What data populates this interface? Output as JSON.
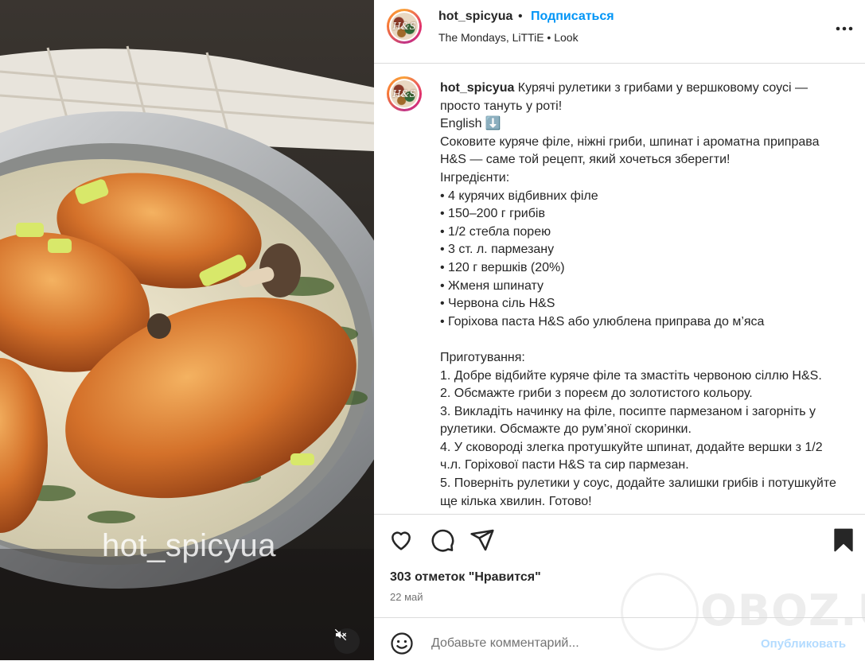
{
  "post": {
    "username": "hot_spicyua",
    "separator": "•",
    "follow_label": "Подписаться",
    "audio_line": "The Mondays, LiTTiE • Look",
    "avatar_text": "H&S",
    "video_watermark": "hot_spicyua"
  },
  "caption": {
    "username": "hot_spicyua",
    "first_line": " Курячі рулетики з грибами у вершковому соусі — просто тануть у роті!",
    "lines": [
      "English ⬇️",
      "Соковите куряче філе, ніжні гриби, шпинат і ароматна приправа H&S — саме той рецепт, який хочеться зберегти!",
      "Інгредієнти:",
      "• 4 курячих відбивних філе",
      "• 150–200 г грибів",
      "• 1/2 стебла порею",
      "• 3 ст. л. пармезану",
      "• 120 г вершків (20%)",
      "• Жменя шпинату",
      "• Червона сіль H&S",
      "• Горіхова паста H&S або улюблена приправа до м’яса",
      "",
      "Приготування:",
      "1. Добре відбийте куряче філе та змастіть червоною сіллю H&S.",
      "2. Обсмажте гриби з пореєм до золотистого кольору.",
      "3. Викладіть начинку на філе, посипте пармезаном і загорніть у рулетики. Обсмажте до рум’яної скоринки.",
      "4. У сковороді злегка протушкуйте шпинат, додайте вершки з 1/2 ч.л. Горіхової пасти H&S та сир пармезан.",
      "5. Поверніть рулетики у соус, додайте залишки грибів і потушкуйте ще кілька хвилин. Готово!"
    ]
  },
  "stats": {
    "likes": "303 отметок \"Нравится\"",
    "date": "22 май"
  },
  "comment": {
    "placeholder": "Добавьте комментарий...",
    "post_label": "Опубликовать"
  },
  "site_watermark": "OBOZ.UA",
  "icons": [
    "heart-icon",
    "comment-icon",
    "share-icon",
    "bookmark-icon",
    "more-icon",
    "emoji-icon",
    "mute-icon"
  ],
  "colors": {
    "accent": "#0095f6",
    "post_disabled": "#b3dbff",
    "text": "#262626",
    "muted": "#737373"
  }
}
